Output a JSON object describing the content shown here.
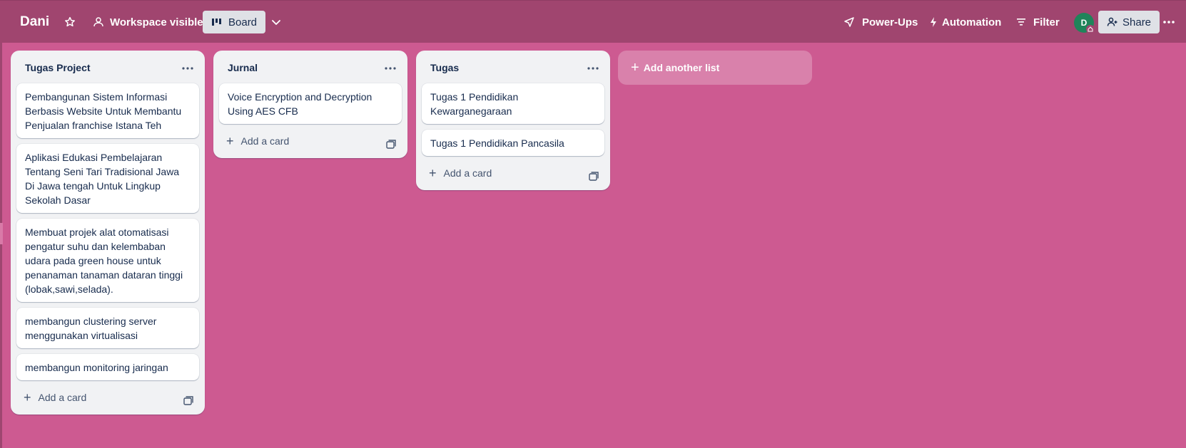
{
  "header": {
    "board_title": "Dani",
    "visibility_label": "Workspace visible",
    "view_label": "Board",
    "powerups_label": "Power-Ups",
    "automation_label": "Automation",
    "filter_label": "Filter",
    "avatar_initial": "D",
    "share_label": "Share"
  },
  "lists": [
    {
      "title": "Tugas Project",
      "cards": [
        "Pembangunan Sistem Informasi Berbasis Website Untuk Membantu Penjualan franchise Istana Teh",
        "Aplikasi Edukasi Pembelajaran Tentang Seni Tari Tradisional Jawa Di Jawa tengah Untuk Lingkup Sekolah Dasar",
        "Membuat projek alat otomatisasi pengatur suhu dan kelembaban udara pada green house untuk penanaman tanaman dataran tinggi (lobak,sawi,selada).",
        "membangun clustering server menggunakan virtualisasi",
        "membangun monitoring jaringan"
      ],
      "add_card_label": "Add a card"
    },
    {
      "title": "Jurnal",
      "cards": [
        "Voice Encryption and Decryption Using AES CFB"
      ],
      "add_card_label": "Add a card"
    },
    {
      "title": "Tugas",
      "cards": [
        "Tugas 1 Pendidikan Kewarganegaraan",
        "Tugas 1 Pendidikan Pancasila"
      ],
      "add_card_label": "Add a card"
    }
  ],
  "add_list_label": "Add another list",
  "colors": {
    "background": "#cd5a91",
    "header": "#a0456f",
    "list": "#f1f2f4",
    "avatar": "#1f845a"
  }
}
